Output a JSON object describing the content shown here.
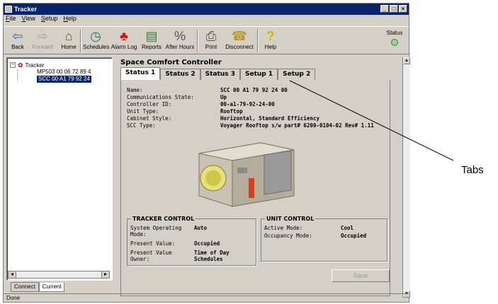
{
  "window": {
    "title": "Tracker",
    "status_bar": "Done"
  },
  "menu": [
    "File",
    "View",
    "Setup",
    "Help"
  ],
  "toolbar": {
    "back": "Back",
    "forward": "Forward",
    "home": "Home",
    "schedules": "Schedules",
    "alarm_log": "Alarm Log",
    "reports": "Reports",
    "after_hours": "After Hours",
    "print": "Print",
    "disconnect": "Disconnect",
    "help": "Help",
    "status_label": "Status",
    "status_color": "#8fd88f"
  },
  "tree": {
    "root": "Tracker",
    "items": [
      "MP503 00 06 72 89 4",
      "SCC 00 A1 79 92 24"
    ]
  },
  "left_tabs": [
    "Connect",
    "Current"
  ],
  "main": {
    "title": "Space Comfort Controller",
    "tabs": [
      "Status 1",
      "Status 2",
      "Status 3",
      "Setup 1",
      "Setup 2"
    ],
    "info": [
      {
        "label": "Name:",
        "value": "SCC 00 A1 79 92 24 00"
      },
      {
        "label": "Communications State:",
        "value": "Up"
      },
      {
        "label": "Controller ID:",
        "value": "00-a1-79-92-24-00"
      },
      {
        "label": "Unit Type:",
        "value": "Rooftop"
      },
      {
        "label": "Cabinet Style:",
        "value": "Horizontal, Standard Efficiency"
      },
      {
        "label": "SCC Type:",
        "value": "Voyager Rooftop s/w part# 6200-0104-02 Rev# 1.11"
      }
    ],
    "tracker_control": {
      "title": "TRACKER CONTROL",
      "system_operating_mode_label": "System Operating Mode:",
      "system_operating_mode": "Auto",
      "present_value_label": "Present Value:",
      "present_value": "Occupied",
      "present_value_owner_label": "Present Value Owner:",
      "present_value_owner": "Time of Day Schedules"
    },
    "unit_control": {
      "title": "UNIT CONTROL",
      "active_mode_label": "Active Mode:",
      "active_mode": "Cool",
      "occupancy_mode_label": "Occupancy Mode:",
      "occupancy_mode": "Occupied"
    },
    "save_label": "Save"
  },
  "callout": {
    "label": "Tabs"
  }
}
